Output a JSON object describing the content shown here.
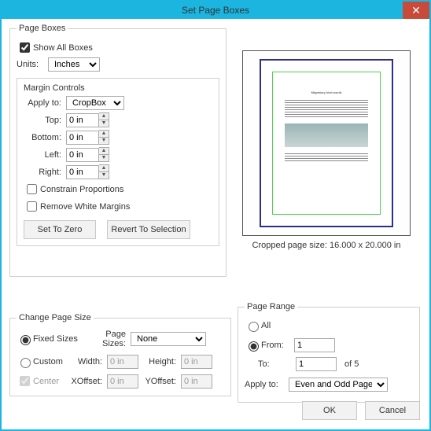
{
  "window": {
    "title": "Set Page Boxes",
    "close_glyph": "✕"
  },
  "pageboxes": {
    "legend": "Page Boxes",
    "show_all": "Show All Boxes",
    "units_label": "Units:",
    "units_value": "Inches",
    "margin_controls": {
      "title": "Margin Controls",
      "apply_to_label": "Apply to:",
      "apply_to_value": "CropBox",
      "top_label": "Top:",
      "top_value": "0 in",
      "bottom_label": "Bottom:",
      "bottom_value": "0 in",
      "left_label": "Left:",
      "left_value": "0 in",
      "right_label": "Right:",
      "right_value": "0 in",
      "constrain": "Constrain Proportions",
      "remove_white": "Remove White Margins",
      "set_zero": "Set To Zero",
      "revert": "Revert To Selection"
    }
  },
  "preview": {
    "cropped_label": "Cropped page size: 16.000 x 20.000 in"
  },
  "changesize": {
    "legend": "Change Page Size",
    "fixed": "Fixed Sizes",
    "custom": "Custom",
    "center": "Center",
    "page_sizes_label": "Page Sizes:",
    "page_sizes_value": "None",
    "width_label": "Width:",
    "width_value": "0 in",
    "height_label": "Height:",
    "height_value": "0 in",
    "xoffset_label": "XOffset:",
    "xoffset_value": "0 in",
    "yoffset_label": "YOffset:",
    "yoffset_value": "0 in"
  },
  "pagerange": {
    "legend": "Page Range",
    "all": "All",
    "from_label": "From:",
    "from_value": "1",
    "to_label": "To:",
    "to_value": "1",
    "of_label": "of 5",
    "apply_to_label": "Apply to:",
    "apply_to_value": "Even and Odd Pages"
  },
  "footer": {
    "ok": "OK",
    "cancel": "Cancel"
  }
}
